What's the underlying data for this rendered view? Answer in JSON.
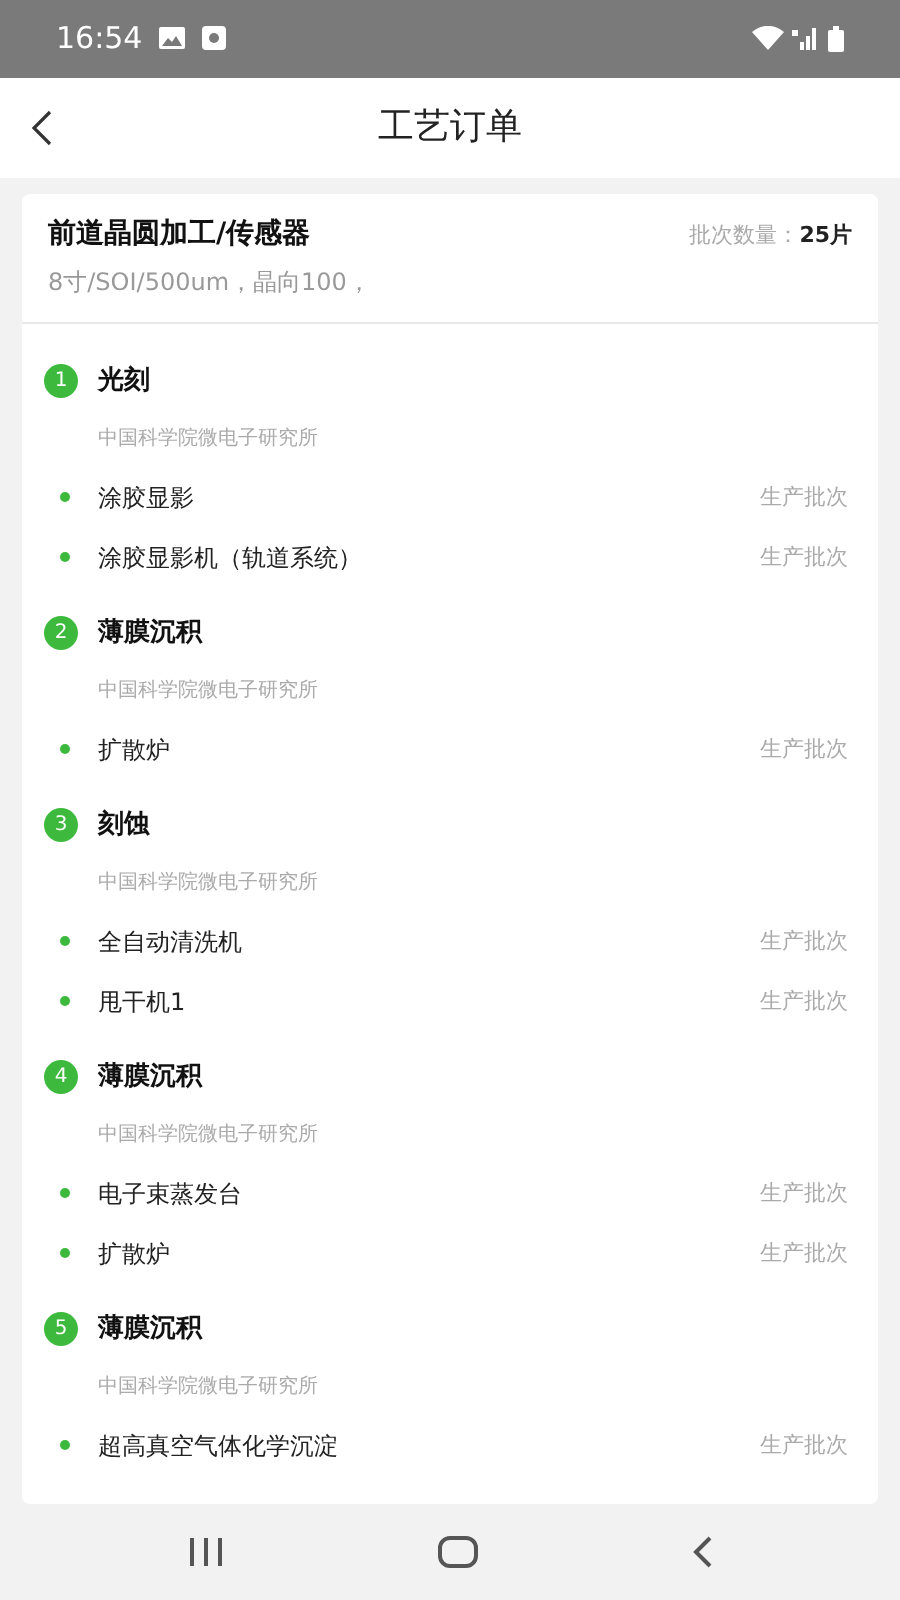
{
  "status_bar": {
    "time": "16:54"
  },
  "header": {
    "title": "工艺订单"
  },
  "order": {
    "name": "前道晶圆加工/传感器",
    "spec": "8寸/SOI/500um，晶向100，",
    "quantity_label": "批次数量：",
    "quantity": "25片"
  },
  "steps": [
    {
      "number": "1",
      "title": "光刻",
      "org": "中国科学院微电子研究所",
      "equipment": [
        {
          "name": "涂胶显影",
          "action": "生产批次"
        },
        {
          "name": "涂胶显影机（轨道系统）",
          "action": "生产批次"
        }
      ]
    },
    {
      "number": "2",
      "title": "薄膜沉积",
      "org": "中国科学院微电子研究所",
      "equipment": [
        {
          "name": "扩散炉",
          "action": "生产批次"
        }
      ]
    },
    {
      "number": "3",
      "title": "刻蚀",
      "org": "中国科学院微电子研究所",
      "equipment": [
        {
          "name": "全自动清洗机",
          "action": "生产批次"
        },
        {
          "name": "甩干机1",
          "action": "生产批次"
        }
      ]
    },
    {
      "number": "4",
      "title": "薄膜沉积",
      "org": "中国科学院微电子研究所",
      "equipment": [
        {
          "name": "电子束蒸发台",
          "action": "生产批次"
        },
        {
          "name": "扩散炉",
          "action": "生产批次"
        }
      ]
    },
    {
      "number": "5",
      "title": "薄膜沉积",
      "org": "中国科学院微电子研究所",
      "equipment": [
        {
          "name": "超高真空气体化学沉淀",
          "action": "生产批次"
        }
      ]
    }
  ]
}
